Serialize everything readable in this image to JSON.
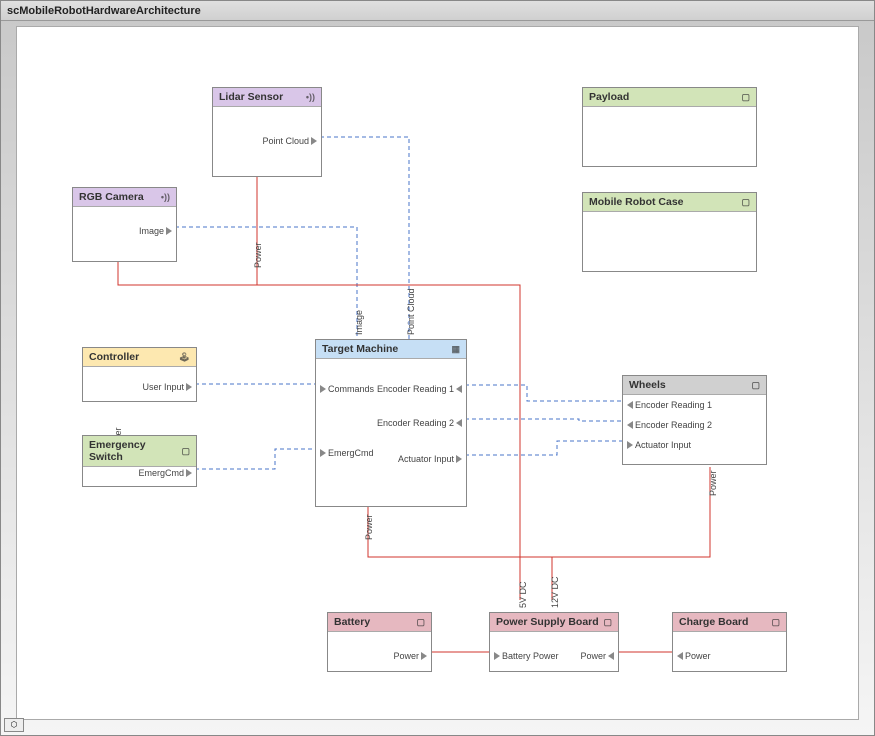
{
  "title": "scMobileRobotHardwareArchitecture",
  "blocks": {
    "lidar": {
      "name": "Lidar Sensor",
      "ports": {
        "out": "Point Cloud",
        "pwr": "Power"
      }
    },
    "rgb": {
      "name": "RGB Camera",
      "ports": {
        "out": "Image",
        "pwr": "Power"
      }
    },
    "controller": {
      "name": "Controller",
      "ports": {
        "out": "User Input"
      }
    },
    "emerg": {
      "name": "Emergency Switch",
      "ports": {
        "out": "EmergCmd"
      }
    },
    "target": {
      "name": "Target Machine",
      "ports": {
        "top1": "Image",
        "top2": "Point Cloud",
        "in1": "Commands",
        "in2": "EmergCmd",
        "r1": "Encoder Reading 1",
        "r2": "Encoder Reading 2",
        "r3": "Actuator Input",
        "pwr": "Power"
      }
    },
    "wheels": {
      "name": "Wheels",
      "ports": {
        "l1": "Encoder Reading 1",
        "l2": "Encoder Reading 2",
        "l3": "Actuator Input",
        "pwr": "Power"
      }
    },
    "payload": {
      "name": "Payload"
    },
    "case": {
      "name": "Mobile Robot Case"
    },
    "battery": {
      "name": "Battery",
      "ports": {
        "out": "Power"
      }
    },
    "psb": {
      "name": "Power Supply Board",
      "ports": {
        "in": "Battery Power",
        "out": "Power",
        "t1": "5V DC",
        "t2": "12V DC"
      }
    },
    "charge": {
      "name": "Charge Board",
      "ports": {
        "l": "Power"
      }
    }
  }
}
